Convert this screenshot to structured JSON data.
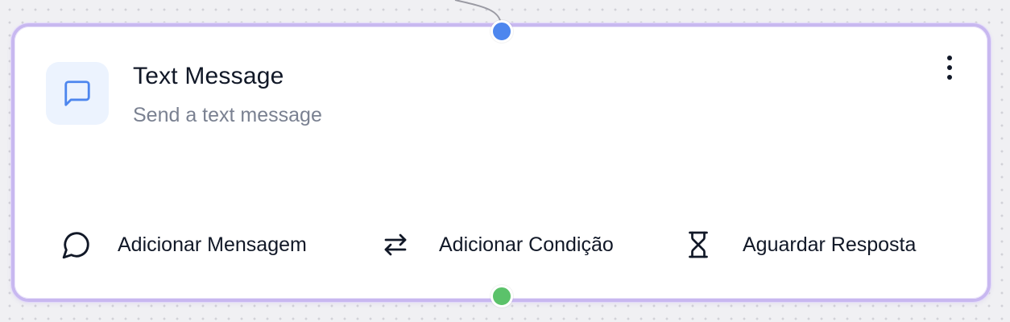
{
  "node": {
    "title": "Text Message",
    "subtitle": "Send a text message",
    "icon": "message-square-icon",
    "more_icon": "more-vertical-icon"
  },
  "actions": [
    {
      "label": "Adicionar Mensagem",
      "icon": "message-circle-icon"
    },
    {
      "label": "Adicionar Condição",
      "icon": "arrows-left-right-icon"
    },
    {
      "label": "Aguardar Resposta",
      "icon": "hourglass-icon"
    }
  ],
  "colors": {
    "card_border": "#c8b8f0",
    "icon_accent": "#4d86ee",
    "icon_tile_bg": "#ecf3fe",
    "input_handle": "#4d86ee",
    "output_handle": "#5bc26a",
    "title_text": "#111827",
    "subtitle_text": "#7a8191"
  }
}
